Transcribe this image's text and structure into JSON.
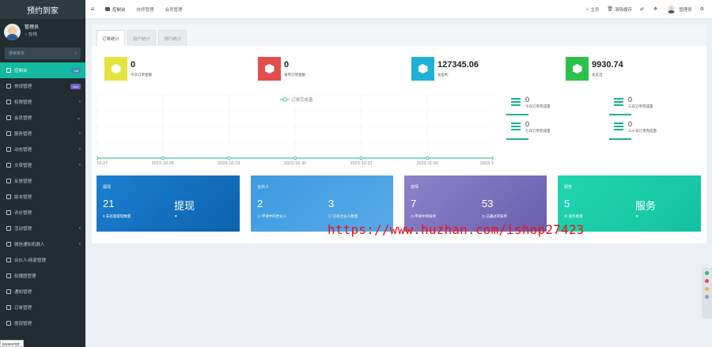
{
  "app_title": "预约到家",
  "user": {
    "name": "管理员",
    "status": "在线"
  },
  "search": {
    "placeholder": "搜索菜单"
  },
  "sidebar": {
    "items": [
      {
        "label": "控制台",
        "badge": "hot",
        "active": true
      },
      {
        "label": "常规管理",
        "badge": "new"
      },
      {
        "label": "权限管理",
        "chevron": "‹"
      },
      {
        "label": "会员管理",
        "chevron": "⌄"
      },
      {
        "label": "服务管理",
        "chevron": "‹"
      },
      {
        "label": "动态管理",
        "chevron": "‹"
      },
      {
        "label": "文章管理",
        "chevron": "‹"
      },
      {
        "label": "反馈管理"
      },
      {
        "label": "版本管理"
      },
      {
        "label": "评价管理"
      },
      {
        "label": "活动管理",
        "chevron": "‹"
      },
      {
        "label": "微信通知机器人",
        "chevron": "‹"
      },
      {
        "label": "合伙人/商家管理"
      },
      {
        "label": "轮播图管理"
      },
      {
        "label": "通知管理"
      },
      {
        "label": "订单管理"
      },
      {
        "label": "提现管理"
      }
    ]
  },
  "status_bar": "javascript:;",
  "topbar": {
    "menu_icon": "≡",
    "tabs": [
      "控制台",
      "技师管理",
      "会员管理"
    ],
    "right": {
      "home": "主页",
      "clear": "清除缓存",
      "user": "管理员"
    }
  },
  "panel_tabs": [
    "订单统计",
    "用户统计",
    "排行统计"
  ],
  "stats": [
    {
      "value": "0",
      "label": "今日订单金额",
      "color": "#e6e23e"
    },
    {
      "value": "0",
      "label": "本月订单金额",
      "color": "#e34d4d"
    },
    {
      "value": "127345.06",
      "label": "总盈利",
      "color": "#1db1d8"
    },
    {
      "value": "9930.74",
      "label": "总支出",
      "color": "#2bc24c"
    }
  ],
  "chart_data": {
    "type": "line",
    "legend": "订单完成量",
    "categories": [
      "10-27",
      "2023-10-28",
      "2023-10-29",
      "2023-10-30",
      "2023-10-31",
      "2023-11-01",
      "2023-1"
    ],
    "series": [
      {
        "name": "订单完成量",
        "values": [
          0,
          0,
          0,
          0,
          0,
          0,
          0
        ]
      }
    ]
  },
  "right_stats": [
    {
      "value": "0",
      "label": "今日订单完成量"
    },
    {
      "value": "0",
      "label": "三日订单完成量"
    },
    {
      "value": "0",
      "label": "七日订单完成量"
    },
    {
      "value": "0",
      "label": "三十日订单完成量"
    }
  ],
  "cards": [
    {
      "title": "提现",
      "big1": "21",
      "sub1": "¥ 未处理提现数量",
      "big2": "提现",
      "sub2": "▼",
      "gradient": [
        "#1c7fd0",
        "#0c62ad"
      ]
    },
    {
      "title": "合伙人",
      "big1": "2",
      "sub1": "申请中的合伙人",
      "big2": "3",
      "sub2": "已有合伙人数量",
      "gradient": [
        "#3d9be0",
        "#58a9e8"
      ]
    },
    {
      "title": "技师",
      "big1": "7",
      "sub1": "申请中的技师",
      "big2": "53",
      "sub2": "已通过的技师",
      "gradient": [
        "#8d83c8",
        "#6a5fb0"
      ]
    },
    {
      "title": "服务",
      "big1": "5",
      "sub1": "服务数量",
      "big2": "服务",
      "sub2": "▼",
      "gradient": [
        "#20d6b0",
        "#14c1a2"
      ]
    }
  ],
  "watermark": "https://www.huzhan.com/ishop27423"
}
